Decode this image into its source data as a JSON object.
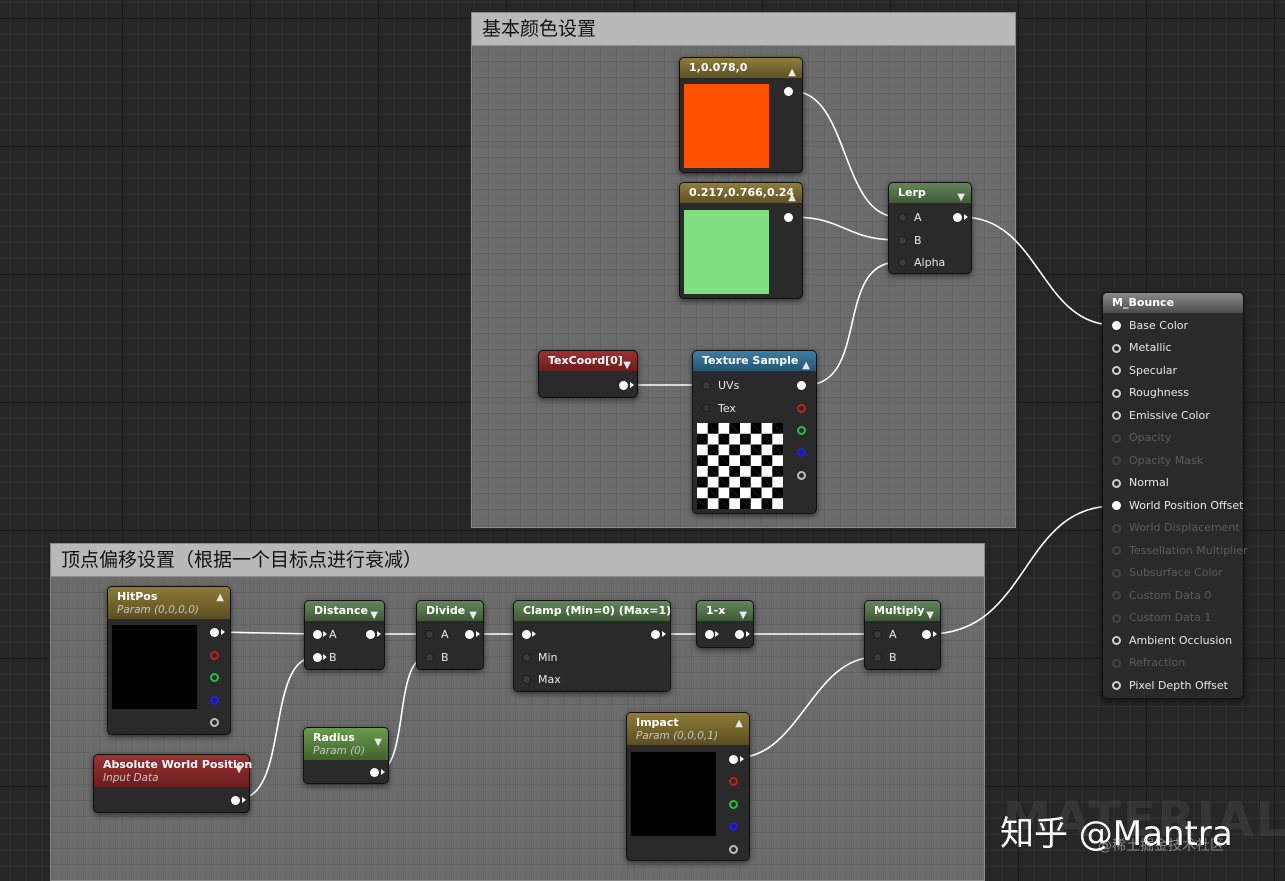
{
  "comments": {
    "base_color_title": "基本颜色设置",
    "vertex_offset_title": "顶点偏移设置（根据一个目标点进行衰减）"
  },
  "colors": {
    "orange_swatch": "#ff5000",
    "green_swatch": "#80e080",
    "wire": "#ffffff",
    "comment_header": "#b9b9b9"
  },
  "nodes": {
    "const_orange": {
      "title": "1,0.078,0"
    },
    "const_green": {
      "title": "0.217,0.766,0.24"
    },
    "lerp": {
      "title": "Lerp",
      "pins": [
        "A",
        "B",
        "Alpha"
      ]
    },
    "texcoord": {
      "title": "TexCoord[0]"
    },
    "texture_sample": {
      "title": "Texture Sample",
      "pins": [
        "UVs",
        "Tex"
      ]
    },
    "hitpos": {
      "title": "HitPos",
      "subtitle": "Param (0,0,0,0)"
    },
    "abs_world_pos": {
      "title": "Absolute World Position",
      "subtitle": "Input Data"
    },
    "distance": {
      "title": "Distance",
      "pins": [
        "A",
        "B"
      ]
    },
    "radius": {
      "title": "Radius",
      "subtitle": "Param (0)"
    },
    "divide": {
      "title": "Divide",
      "pins": [
        "A",
        "B"
      ]
    },
    "clamp": {
      "title": "Clamp (Min=0) (Max=1)",
      "pins": [
        "Min",
        "Max"
      ]
    },
    "one_minus": {
      "title": "1-x"
    },
    "multiply": {
      "title": "Multiply",
      "pins": [
        "A",
        "B"
      ]
    },
    "impact": {
      "title": "Impact",
      "subtitle": "Param (0,0,0,1)"
    },
    "material": {
      "title": "M_Bounce",
      "inputs": [
        {
          "label": "Base Color",
          "active": true
        },
        {
          "label": "Metallic",
          "active": true
        },
        {
          "label": "Specular",
          "active": true
        },
        {
          "label": "Roughness",
          "active": true
        },
        {
          "label": "Emissive Color",
          "active": true
        },
        {
          "label": "Opacity",
          "active": false
        },
        {
          "label": "Opacity Mask",
          "active": false
        },
        {
          "label": "Normal",
          "active": true
        },
        {
          "label": "World Position Offset",
          "active": true
        },
        {
          "label": "World Displacement",
          "active": false
        },
        {
          "label": "Tessellation Multiplier",
          "active": false
        },
        {
          "label": "Subsurface Color",
          "active": false
        },
        {
          "label": "Custom Data 0",
          "active": false
        },
        {
          "label": "Custom Data 1",
          "active": false
        },
        {
          "label": "Ambient Occlusion",
          "active": true
        },
        {
          "label": "Refraction",
          "active": false
        },
        {
          "label": "Pixel Depth Offset",
          "active": true
        }
      ]
    }
  },
  "watermark": {
    "background_word": "MATERIAL",
    "brand": "知乎 @Mantra",
    "sub": "@稀土掘金技术社区"
  }
}
